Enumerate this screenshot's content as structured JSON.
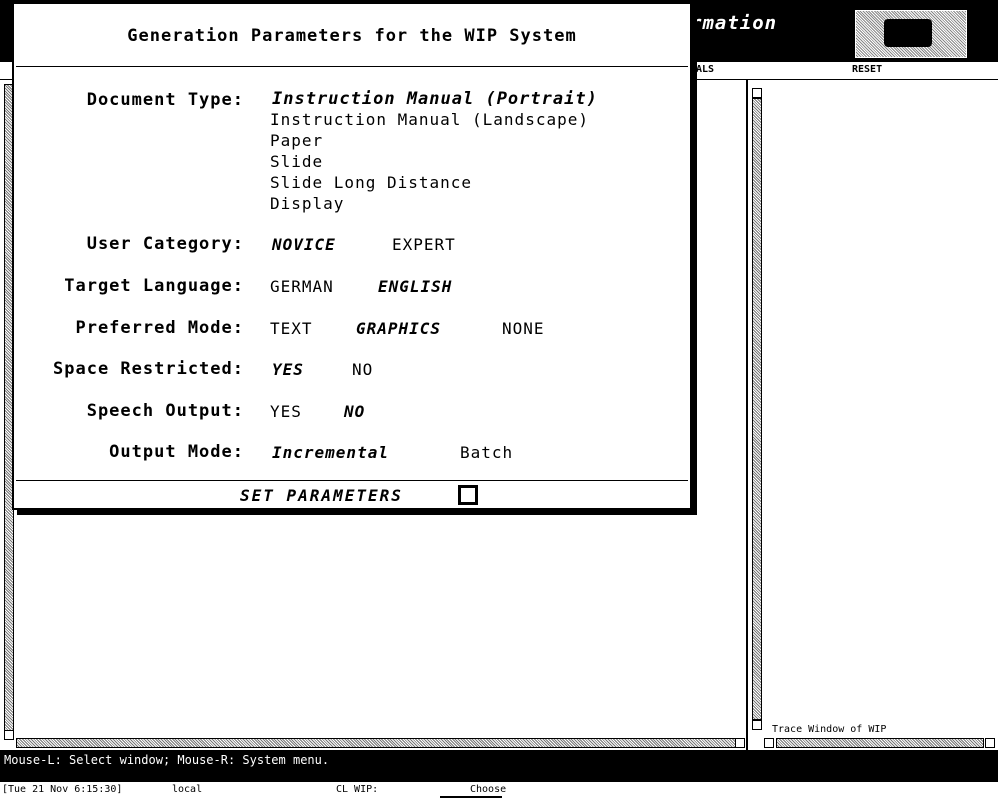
{
  "window": {
    "app_title": "rmation",
    "menu": {
      "goals": "OALS",
      "reset": "RESET"
    },
    "trace_window_label": "Trace Window of WIP"
  },
  "dialog": {
    "title": "Generation Parameters for the WIP System",
    "document_type": {
      "label": "Document Type:",
      "options": [
        "Instruction Manual (Portrait)",
        "Instruction Manual (Landscape)",
        "Paper",
        "Slide",
        "Slide Long Distance",
        "Display"
      ],
      "selected": "Instruction Manual (Portrait)"
    },
    "user_category": {
      "label": "User Category:",
      "options": [
        "NOVICE",
        "EXPERT"
      ],
      "selected": "NOVICE"
    },
    "target_language": {
      "label": "Target Language:",
      "options": [
        "GERMAN",
        "ENGLISH"
      ],
      "selected": "ENGLISH"
    },
    "preferred_mode": {
      "label": "Preferred Mode:",
      "options": [
        "TEXT",
        "GRAPHICS",
        "NONE"
      ],
      "selected": "GRAPHICS"
    },
    "space_restricted": {
      "label": "Space Restricted:",
      "options": [
        "YES",
        "NO"
      ],
      "selected": "YES"
    },
    "speech_output": {
      "label": "Speech Output:",
      "options": [
        "YES",
        "NO"
      ],
      "selected": "NO"
    },
    "output_mode": {
      "label": "Output Mode:",
      "options": [
        "Incremental",
        "Batch"
      ],
      "selected": "Incremental"
    },
    "submit_label": "SET PARAMETERS"
  },
  "status": {
    "mouse_help": "Mouse-L: Select window; Mouse-R: System menu.",
    "clock": "[Tue 21 Nov 6:15:30]",
    "host": "local",
    "package": "CL WIP:",
    "state": "Choose"
  }
}
